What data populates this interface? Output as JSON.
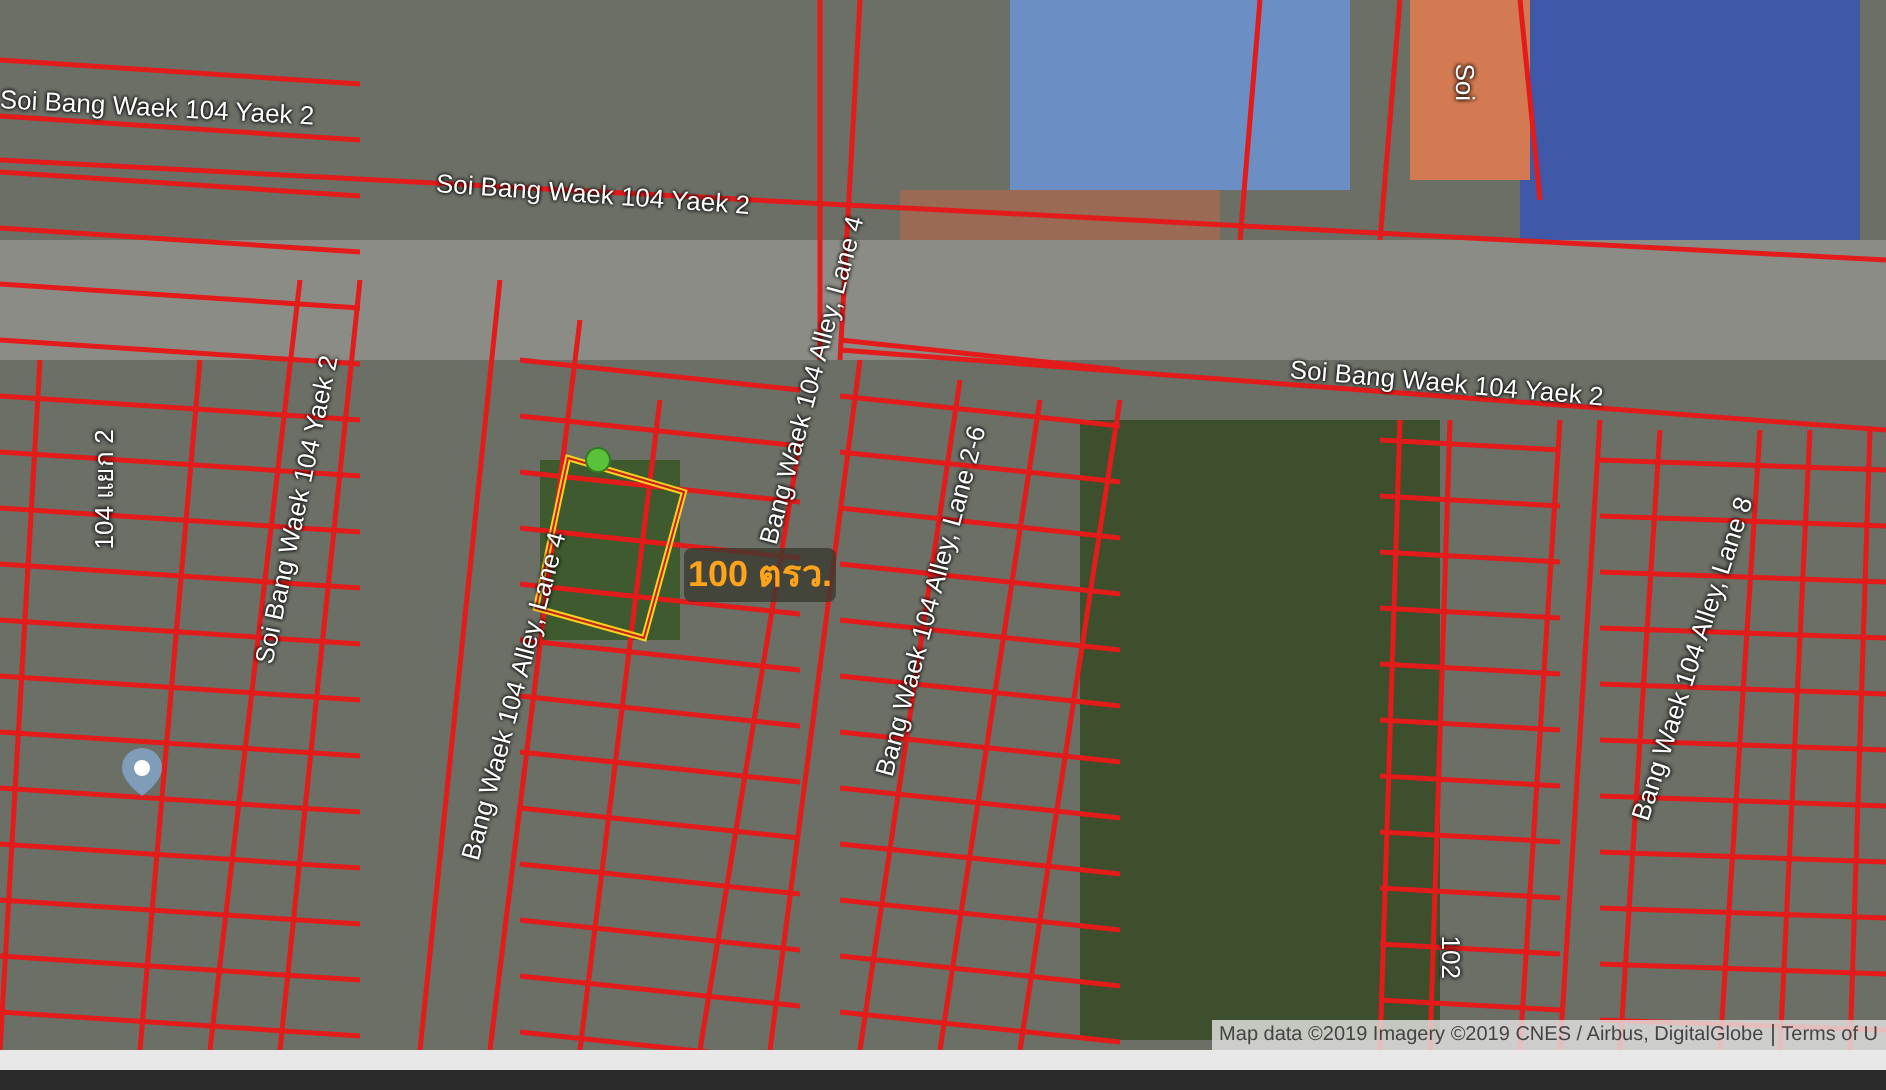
{
  "map": {
    "road_labels": [
      {
        "text": "Soi Bang Waek 104 Yaek 2"
      },
      {
        "text": "Soi Bang Waek 104 Yaek 2"
      },
      {
        "text": "Soi Bang Waek 104 Yaek 2"
      },
      {
        "text": "Soi"
      },
      {
        "text": "104 แยก 2"
      },
      {
        "text": "Soi Bang Waek 104 Yaek 2"
      },
      {
        "text": "Bang Waek 104 Alley, Lane 4"
      },
      {
        "text": "Bang Waek 104 Alley, Lane 4"
      },
      {
        "text": "Bang Waek 104 Alley, Lane 2-6"
      },
      {
        "text": "102"
      },
      {
        "text": "Bang Waek 104 Alley, Lane 8"
      }
    ],
    "plot": {
      "area_label": "100 ตรว."
    },
    "attribution": {
      "text": "Map data ©2019 Imagery ©2019 CNES / Airbus, DigitalGlobe",
      "link": "Terms of U"
    }
  }
}
